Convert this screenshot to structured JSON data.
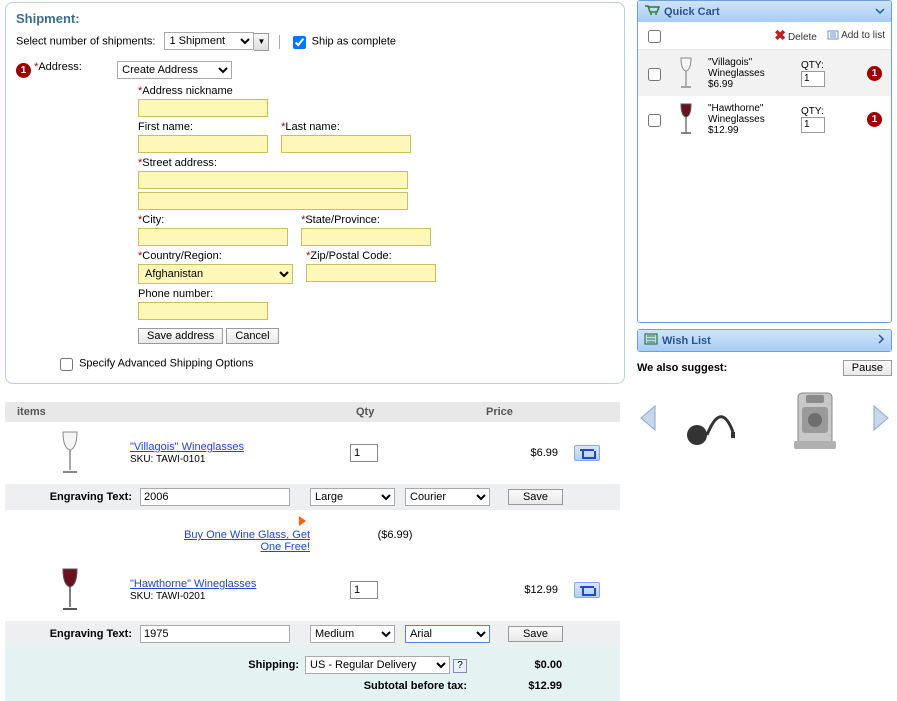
{
  "shipment": {
    "title": "Shipment:",
    "select_lbl": "Select number of shipments:",
    "shipments_opt": "1 Shipment",
    "ship_complete": "Ship as complete",
    "step_badge": "1",
    "address_label": "Address:",
    "address_select": "Create Address",
    "fields": {
      "nickname": "Address nickname",
      "first_name": "First name:",
      "last_name": "Last name:",
      "street": "Street address:",
      "city": "City:",
      "state": "State/Province:",
      "country": "Country/Region:",
      "zip": "Zip/Postal Code:",
      "phone": "Phone number:"
    },
    "country_value": "Afghanistan",
    "save_btn": "Save address",
    "cancel_btn": "Cancel",
    "adv_opts": "Specify Advanced Shipping Options"
  },
  "items_header": {
    "col1": "items",
    "col2": "Qty",
    "col3": "Price"
  },
  "items": [
    {
      "name": "\"Villagois\" Wineglasses",
      "sku": "SKU: TAWI-0101",
      "qty": "1",
      "price": "$6.99",
      "engrave_text": "2006",
      "size": "Large",
      "font": "Courier"
    },
    {
      "name": "\"Hawthorne\" Wineglasses",
      "sku": "SKU: TAWI-0201",
      "qty": "1",
      "price": "$12.99",
      "engrave_text": "1975",
      "size": "Medium",
      "font": "Arial"
    }
  ],
  "engrave_label": "Engraving Text:",
  "save_label": "Save",
  "promo": {
    "text": "Buy One Wine Glass, Get One Free!",
    "price": "($6.99)"
  },
  "totals": {
    "shipping_lbl": "Shipping:",
    "shipping_opt": "US - Regular Delivery",
    "shipping_val": "$0.00",
    "subtotal_lbl": "Subtotal before tax:",
    "subtotal_val": "$12.99"
  },
  "quickcart": {
    "title": "Quick Cart",
    "delete": "Delete",
    "addlist": "Add to list",
    "qty_lbl": "QTY:",
    "items": [
      {
        "name": "\"Villagois\" Wineglasses",
        "price": "$6.99",
        "qty": "1",
        "badge": "1"
      },
      {
        "name": "\"Hawthorne\" Wineglasses",
        "price": "$12.99",
        "qty": "1",
        "badge": "1"
      }
    ]
  },
  "wishlist": {
    "title": "Wish List"
  },
  "suggest": {
    "title": "We also suggest:",
    "pause": "Pause"
  }
}
